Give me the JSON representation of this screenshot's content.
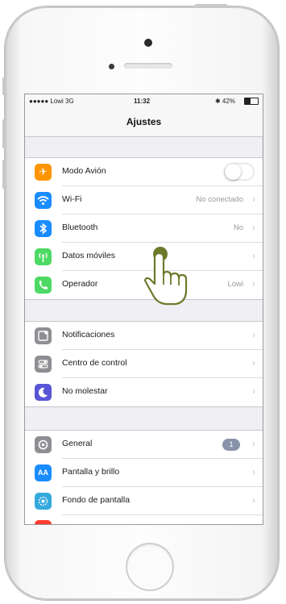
{
  "status_bar": {
    "carrier": "●●●●● Lowi  3G",
    "time": "11:32",
    "battery": "✱ 42%"
  },
  "nav": {
    "title": "Ajustes"
  },
  "groups": [
    {
      "rows": [
        {
          "label": "Modo Avión",
          "icon": "airplane-icon",
          "color": "#ff9500",
          "toggle": "off"
        },
        {
          "label": "Wi-Fi",
          "value": "No conectado",
          "icon": "wifi-icon",
          "color": "#1a8cff"
        },
        {
          "label": "Bluetooth",
          "value": "No",
          "icon": "bluetooth-icon",
          "color": "#1a8cff"
        },
        {
          "label": "Datos móviles",
          "value": "",
          "icon": "antenna-icon",
          "color": "#4cd964"
        },
        {
          "label": "Operador",
          "value": "Lowi",
          "icon": "phone-icon",
          "color": "#4cd964"
        }
      ]
    },
    {
      "rows": [
        {
          "label": "Notificaciones",
          "icon": "notifications-icon",
          "color": "#8e8e93"
        },
        {
          "label": "Centro de control",
          "icon": "control-center-icon",
          "color": "#8e8e93"
        },
        {
          "label": "No molestar",
          "icon": "moon-icon",
          "color": "#5856d6"
        }
      ]
    },
    {
      "rows": [
        {
          "label": "General",
          "badge": "1",
          "icon": "gear-icon",
          "color": "#8e8e93"
        },
        {
          "label": "Pantalla y brillo",
          "icon": "text-size-icon",
          "color": "#1a8cff"
        },
        {
          "label": "Fondo de pantalla",
          "icon": "wallpaper-icon",
          "color": "#34aadc"
        }
      ]
    }
  ],
  "colors": {
    "accent": "#1a8cff",
    "hand": "#6b7a2a"
  }
}
